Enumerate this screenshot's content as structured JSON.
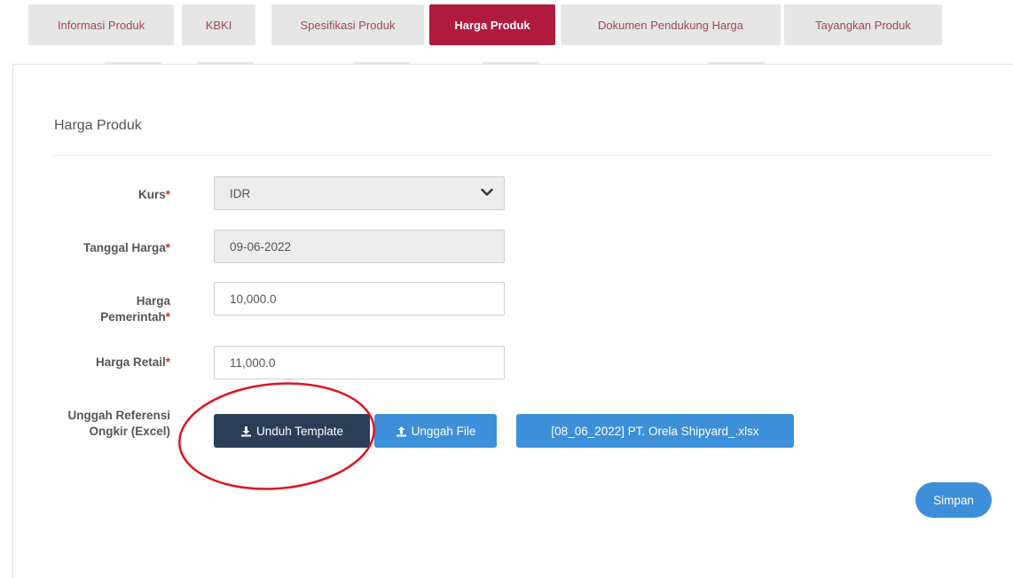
{
  "tabs": [
    {
      "label": "Informasi Produk"
    },
    {
      "label": "KBKI"
    },
    {
      "label": "Spesifikasi Produk"
    },
    {
      "label": "Harga Produk"
    },
    {
      "label": "Dokumen Pendukung Harga"
    },
    {
      "label": "Tayangkan Produk"
    }
  ],
  "form": {
    "title": "Harga Produk",
    "required_mark": "*",
    "kurs": {
      "label": "Kurs",
      "value": "IDR"
    },
    "tanggal_harga": {
      "label": "Tanggal Harga",
      "value": "09-06-2022"
    },
    "harga_pemerintah": {
      "label_line1": "Harga",
      "label_line2": "Pemerintah",
      "value": "10,000.0"
    },
    "harga_retail": {
      "label": "Harga Retail",
      "value": "11,000.0"
    },
    "unggah_referensi": {
      "label_line1": "Unggah Referensi",
      "label_line2": "Ongkir (Excel)"
    },
    "buttons": {
      "unduh_template": "Unduh Template",
      "unggah_file": "Unggah File",
      "uploaded_file": "[08_06_2022] PT. Orela Shipyard_.xlsx",
      "simpan": "Simpan"
    }
  },
  "colors": {
    "active_tab": "#b01a3d",
    "dark_button": "#2c3e57",
    "blue_button": "#3d8fd9",
    "annotation_circle": "#e0141e"
  },
  "icons": {
    "kurs_dropdown": "chevron-down-icon",
    "unduh_template": "download-icon",
    "unggah_file": "upload-icon"
  }
}
